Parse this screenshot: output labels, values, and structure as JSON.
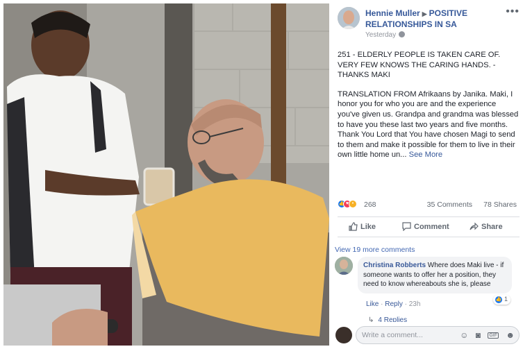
{
  "post": {
    "author": "Hennie Muller",
    "group": "POSITIVE RELATIONSHIPS IN SA",
    "time": "Yesterday",
    "headline": "251 - ELDERLY PEOPLE IS TAKEN CARE OF. VERY FEW KNOWS THE CARING HANDS. - THANKS MAKI",
    "body": "TRANSLATION FROM Afrikaans by Janika. Maki, I honor you for who you are and the experience you've given us. Grandpa and grandma was blessed to have you these last two years and five months. Thank You Lord that You have chosen Magi to send to them and make it possible for them to live in their own little home un...",
    "see_more": "See More",
    "reaction_count": "268",
    "comments_count": "35 Comments",
    "shares_count": "78 Shares"
  },
  "actions": {
    "like": "Like",
    "comment": "Comment",
    "share": "Share"
  },
  "comments_section": {
    "view_more": "View 19 more comments",
    "comment": {
      "name": "Christina Robberts",
      "text": "Where does Maki live - if someone wants to offer her a position, they need to know whereabouts she is, please",
      "like": "Like",
      "reply": "Reply",
      "time": "23h",
      "reaction_count": "1"
    },
    "replies": "4 Replies"
  },
  "composer": {
    "placeholder": "Write a comment..."
  },
  "colors": {
    "link": "#365899",
    "like_blue": "#1877f2",
    "love_red": "#f33e58",
    "wow_yellow": "#f7b125",
    "muted": "#606770"
  }
}
